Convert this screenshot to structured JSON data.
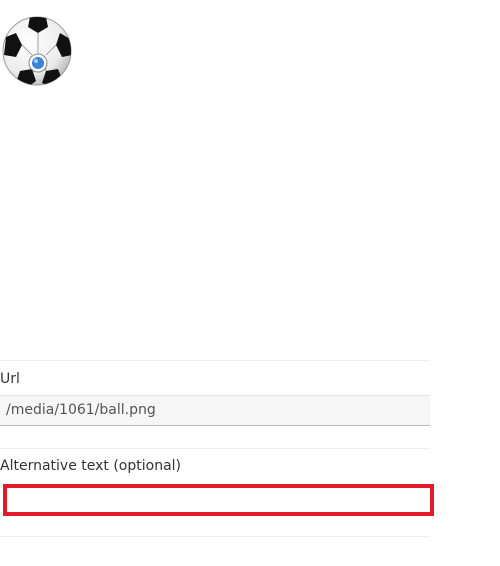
{
  "image": {
    "alt": "ball.png",
    "icon": "soccer-ball-icon"
  },
  "fields": {
    "url_label": "Url",
    "url_value": "/media/1061/ball.png",
    "alt_label": "Alternative text (optional)",
    "alt_value": "",
    "alt_placeholder": ""
  },
  "colors": {
    "focus_border": "#e01b2b",
    "url_background": "#f6f6f6",
    "divider": "#eeeeee",
    "ball_accent": "#3b82d8"
  }
}
